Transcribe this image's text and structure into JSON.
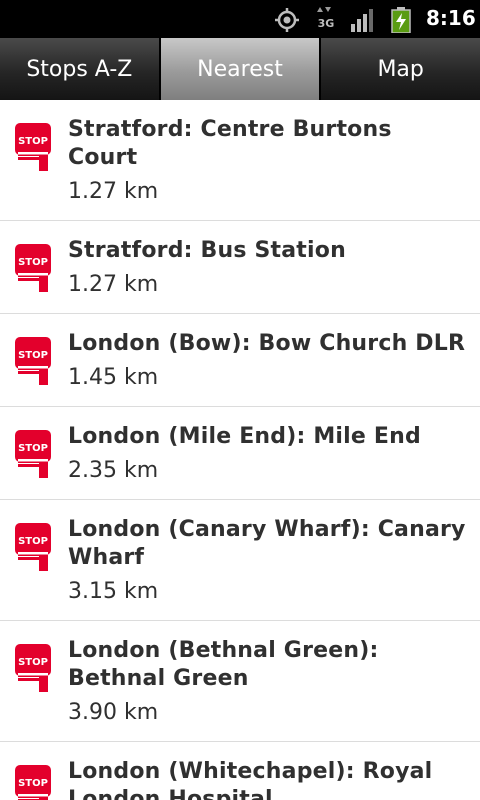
{
  "status_bar": {
    "time": "8:16",
    "network_label": "3G",
    "icons": [
      "gps-icon",
      "network-3g-icon",
      "signal-icon",
      "battery-charging-icon"
    ]
  },
  "tabs": [
    {
      "label": "Stops A-Z",
      "selected": false
    },
    {
      "label": "Nearest",
      "selected": true
    },
    {
      "label": "Map",
      "selected": false
    }
  ],
  "stop_icon_text": "STOP",
  "colors": {
    "stop_red": "#e3002c",
    "text": "#303030"
  },
  "stops": [
    {
      "name": "Stratford: Centre Burtons Court",
      "distance": "1.27 km"
    },
    {
      "name": "Stratford: Bus Station",
      "distance": "1.27 km"
    },
    {
      "name": "London (Bow): Bow Church DLR",
      "distance": "1.45 km"
    },
    {
      "name": "London (Mile End): Mile End",
      "distance": "2.35 km"
    },
    {
      "name": "London (Canary Wharf): Canary Wharf",
      "distance": "3.15 km"
    },
    {
      "name": "London (Bethnal Green): Bethnal Green",
      "distance": "3.90 km"
    },
    {
      "name": "London (Whitechapel): Royal London Hospital",
      "distance": ""
    }
  ]
}
